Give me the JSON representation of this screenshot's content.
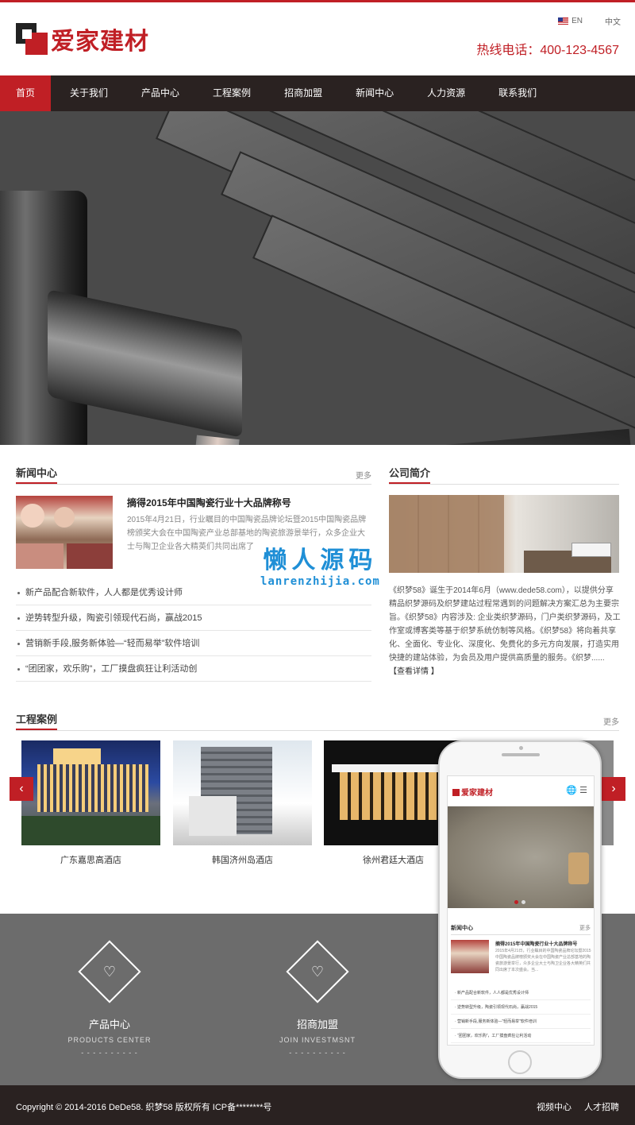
{
  "header": {
    "logo_text": "爱家建材",
    "lang_en": "EN",
    "lang_cn": "中文",
    "hotline": "热线电话：400-123-4567"
  },
  "nav": [
    "首页",
    "关于我们",
    "产品中心",
    "工程案例",
    "招商加盟",
    "新闻中心",
    "人力资源",
    "联系我们"
  ],
  "banner": {
    "slides": 2,
    "active_slide": 2
  },
  "news": {
    "title": "新闻中心",
    "more": "更多",
    "feature_title": "摘得2015年中国陶瓷行业十大品牌称号",
    "feature_desc": "2015年4月21日，行业瞩目的中国陶瓷品牌论坛暨2015中国陶瓷品牌榜颁奖大会在中国陶瓷产业总部基地的陶瓷旅游景举行，众多企业大士与陶卫企业各大精英们共同出席了",
    "items": [
      "新产品配合新软件，人人都是优秀设计师",
      "逆势转型升级，陶瓷引领现代石尚，赢战2015",
      "营销新手段,服务新体验—“轻而易举”软件培训",
      "“团团家，欢乐购”，工厂摸盘疯狂让利活动创"
    ]
  },
  "about": {
    "title": "公司简介",
    "text": "《织梦58》诞生于2014年6月（www.dede58.com），以提供分享精品织梦源码及织梦建站过程常遇到的问题解决方案汇总为主要宗旨。《织梦58》内容涉及: 企业类织梦源码，门户类织梦源码，及工作室或博客类等基于织梦系统仿制等风格。《织梦58》将向着共享化、全面化、专业化、深度化、免费化的多元方向发展，打造实用快捷的建站体验，为会员及用户提供高质量的服务。《织梦...... ",
    "link": "【查看详情 】"
  },
  "watermark": {
    "big": "懒人源码",
    "small": "lanrenzhijia.com"
  },
  "cases": {
    "title": "工程案例",
    "more": "更多",
    "items": [
      "广东嘉思高酒店",
      "韩国济州岛酒店",
      "徐州君廷大酒店"
    ],
    "prev": "‹",
    "next": "›"
  },
  "features": [
    {
      "cn": "产品中心",
      "en": "PRODUCTS  CENTER",
      "dash": "- - - - - - - - - -"
    },
    {
      "cn": "招商加盟",
      "en": "JOIN  INVESTMSNT",
      "dash": "- - - - - - - - - -"
    }
  ],
  "phone": {
    "logo": "爱家建材",
    "icons": "🌐 ☰",
    "news_title": "新闻中心",
    "more": "更多",
    "feature_title": "摘得2015年中国陶瓷行业十大品牌称号",
    "feature_desc": "2015年4月21日，行业瞩目的中国陶瓷品牌论坛暨2015中国陶瓷品牌榜颁奖大会在中国陶瓷产业总部基地的陶瓷旅游景举行，众多企业大士与陶卫企业各大精英们共同出席了本次盛会。当...",
    "items": [
      "· 新产品配合新软件，人人都是优秀设计师",
      "· 逆势转型升级，陶瓷引领现代石尚，赢战2015",
      "· 营销新手段,服务新体验—“轻而易举”软件培训",
      "· “团团家，欢乐购”，工厂摸盘疯狂让利活动"
    ]
  },
  "footer": {
    "copyright": "Copyright © 2014-2016 DeDe58. 织梦58 版权所有    ICP备********号",
    "links": [
      "视频中心",
      "人才招聘"
    ]
  },
  "colors": {
    "brand_red": "#c01f25",
    "nav_bg": "#2a2221",
    "band_gray": "#6c6c6c"
  }
}
